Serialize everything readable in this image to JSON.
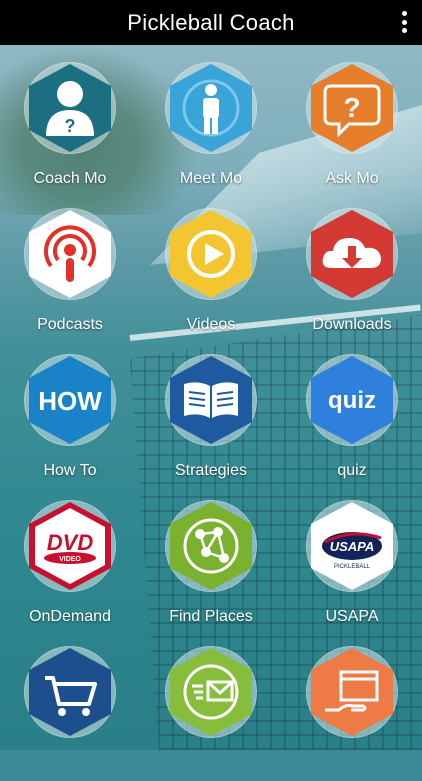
{
  "app": {
    "title": "Pickleball Coach"
  },
  "tiles": [
    {
      "label": "Coach Mo",
      "icon": "coach-person-icon",
      "color": "#1c6f80"
    },
    {
      "label": "Meet Mo",
      "icon": "person-standing-icon",
      "color": "#3aa4d8"
    },
    {
      "label": "Ask Mo",
      "icon": "question-bubble-icon",
      "color": "#e57d2a"
    },
    {
      "label": "Podcasts",
      "icon": "podcast-icon",
      "color": "#ffffff"
    },
    {
      "label": "Videos",
      "icon": "play-icon",
      "color": "#f2c531"
    },
    {
      "label": "Downloads",
      "icon": "cloud-download-icon",
      "color": "#d23a33"
    },
    {
      "label": "How To",
      "icon": "how-text-icon",
      "color": "#1a83c7"
    },
    {
      "label": "Strategies",
      "icon": "open-book-icon",
      "color": "#1f5aa0"
    },
    {
      "label": "quiz",
      "icon": "quiz-text-icon",
      "color": "#2f7fdc"
    },
    {
      "label": "OnDemand",
      "icon": "dvd-icon",
      "color": "#ffffff"
    },
    {
      "label": "Find Places",
      "icon": "network-icon",
      "color": "#7ab22f"
    },
    {
      "label": "USAPA",
      "icon": "usapa-logo-icon",
      "color": "#ffffff"
    },
    {
      "label": "",
      "icon": "cart-icon",
      "color": "#1c4f8c"
    },
    {
      "label": "",
      "icon": "mail-icon",
      "color": "#86be3c"
    },
    {
      "label": "",
      "icon": "hand-screen-icon",
      "color": "#ee7a45"
    }
  ],
  "icon_text": {
    "how": "HOW",
    "quiz": "quiz",
    "dvd": "DVD",
    "dvd_sub": "VIDEO",
    "usapa": "USAPA",
    "usapa_sub": "PICKLEBALL"
  }
}
